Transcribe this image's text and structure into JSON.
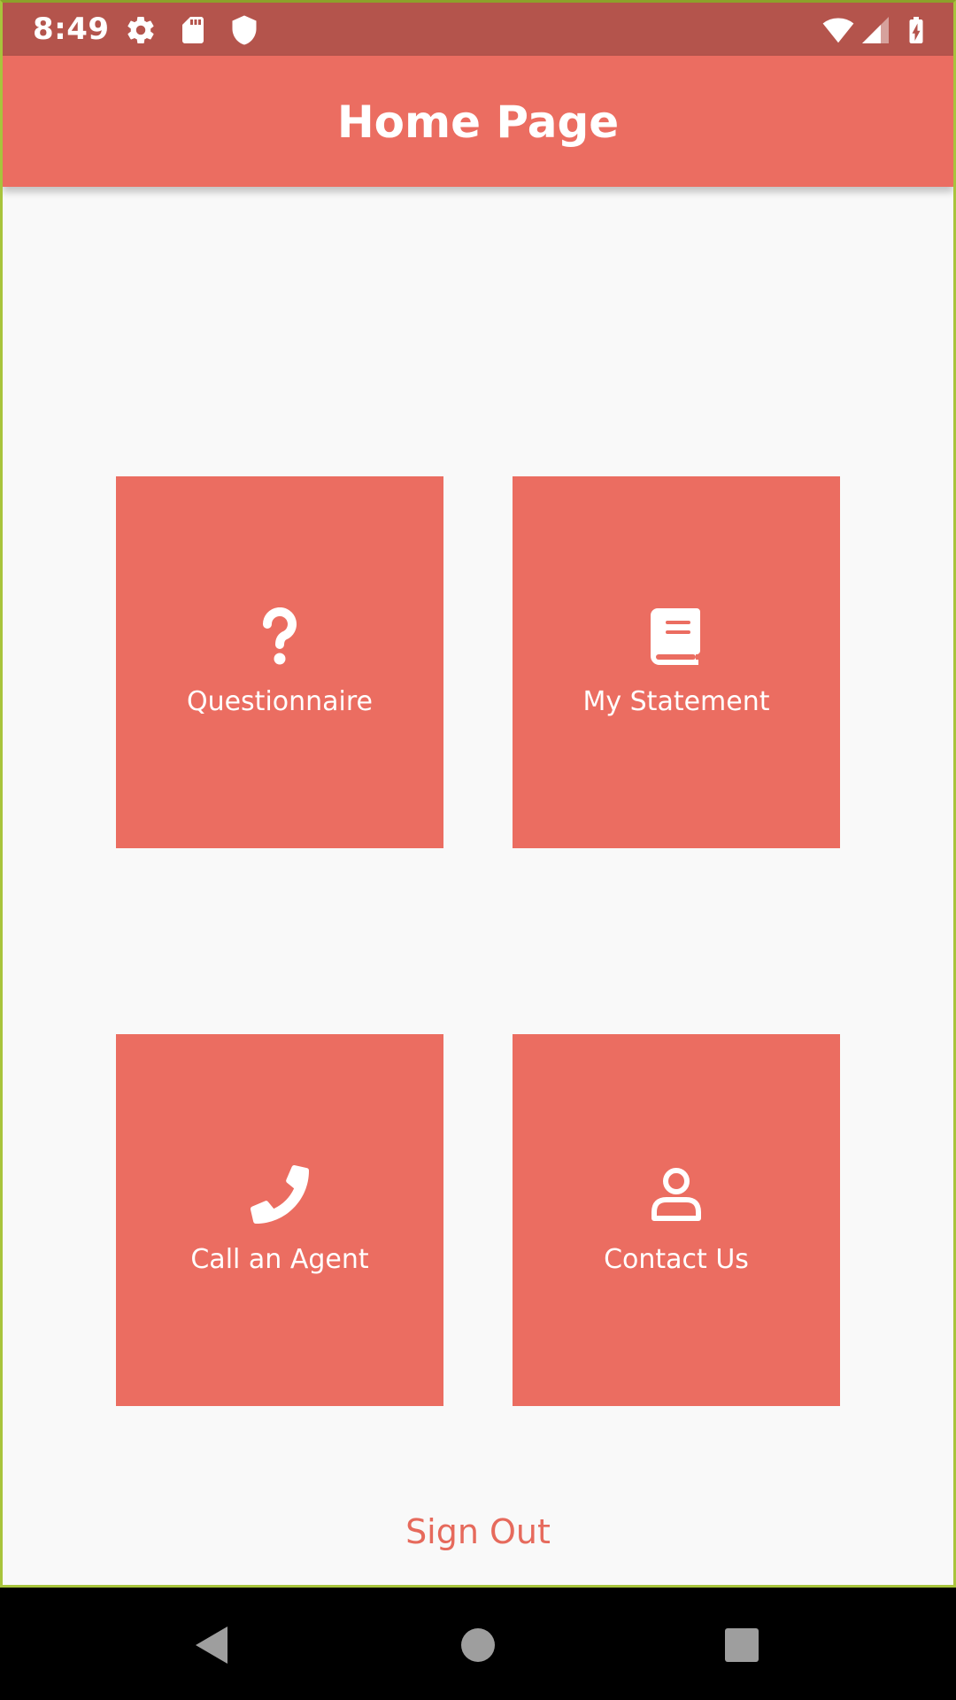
{
  "status_bar": {
    "time": "8:49",
    "icons": [
      "gear-icon",
      "sd-card-icon",
      "shield-icon",
      "wifi-icon",
      "signal-icon",
      "battery-charging-icon"
    ]
  },
  "app_bar": {
    "title": "Home Page"
  },
  "tiles": [
    {
      "label": "Questionnaire",
      "icon": "question-icon"
    },
    {
      "label": "My Statement",
      "icon": "book-icon"
    },
    {
      "label": "Call an Agent",
      "icon": "phone-icon"
    },
    {
      "label": "Contact Us",
      "icon": "person-icon"
    }
  ],
  "sign_out": {
    "label": "Sign Out"
  },
  "nav_bar": {
    "buttons": [
      "back-icon",
      "home-icon",
      "recents-icon"
    ]
  },
  "colors": {
    "primary": "#eb6d61",
    "status_bar": "#b4544c",
    "background": "#f9f9f9",
    "sign_out_text": "#e66a5c"
  }
}
